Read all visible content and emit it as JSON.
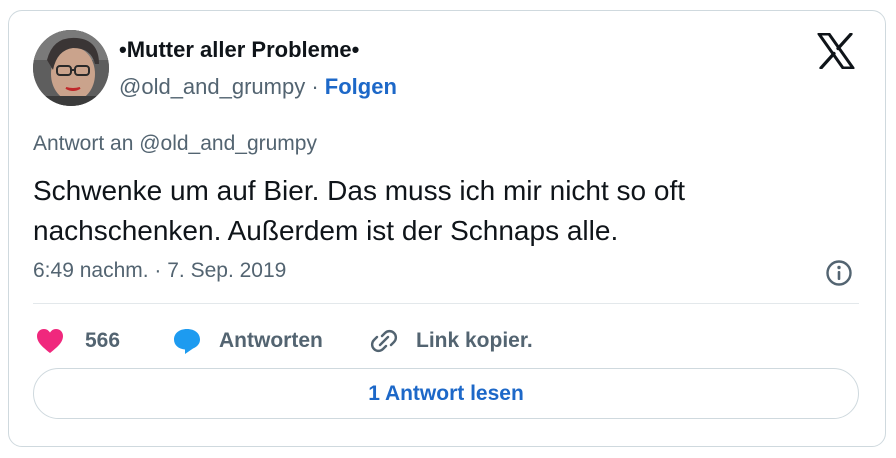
{
  "author": {
    "display_name": "•Mutter aller Probleme•",
    "handle": "@old_and_grumpy",
    "separator": " · ",
    "follow_label": "Folgen",
    "avatar_icon": "user-avatar-photo"
  },
  "platform_icon": "x-logo-icon",
  "tweet": {
    "reply_to": "Antwort an @old_and_grumpy",
    "text": "Schwenke um auf Bier. Das muss ich mir nicht so oft nachschenken. Außerdem ist der Schnaps alle.",
    "timestamp": "6:49 nachm. · 7. Sep. 2019"
  },
  "actions": {
    "like_count": "566",
    "reply_label": "Antworten",
    "copy_link_label": "Link kopier."
  },
  "read_replies_label": "1 Antwort lesen",
  "colors": {
    "accent": "#1d68c8",
    "like": "#f0287d",
    "reply_icon": "#1d9bf0",
    "muted": "#536471",
    "text": "#0f1419",
    "border": "#cfd9de"
  }
}
